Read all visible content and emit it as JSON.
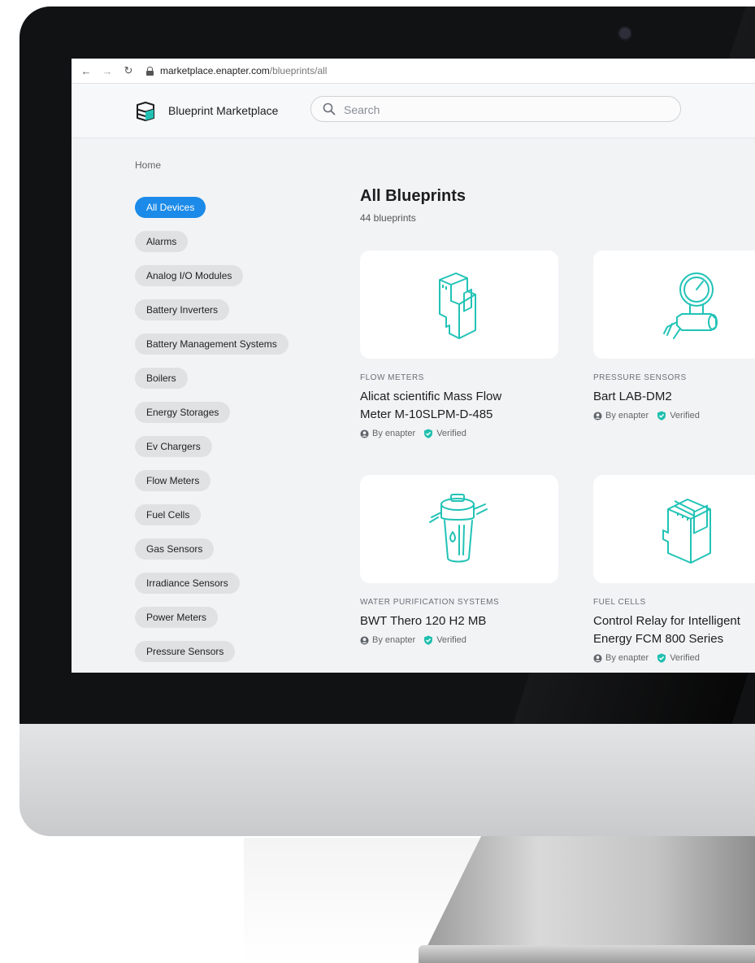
{
  "browser": {
    "url_host": "marketplace.enapter.com",
    "url_path": "/blueprints/all"
  },
  "header": {
    "brand": "Blueprint Marketplace",
    "search_placeholder": "Search"
  },
  "breadcrumb": "Home",
  "sidebar": {
    "items": [
      {
        "label": "All Devices",
        "active": true
      },
      {
        "label": "Alarms"
      },
      {
        "label": "Analog I/O Modules"
      },
      {
        "label": "Battery Inverters"
      },
      {
        "label": "Battery Management Systems"
      },
      {
        "label": "Boilers"
      },
      {
        "label": "Energy Storages"
      },
      {
        "label": "Ev Chargers"
      },
      {
        "label": "Flow Meters"
      },
      {
        "label": "Fuel Cells"
      },
      {
        "label": "Gas Sensors"
      },
      {
        "label": "Irradiance Sensors"
      },
      {
        "label": "Power Meters"
      },
      {
        "label": "Pressure Sensors"
      }
    ]
  },
  "main": {
    "title": "All Blueprints",
    "count": "44 blueprints",
    "cards": [
      {
        "category": "FLOW METERS",
        "title_line1": "Alicat scientific Mass Flow",
        "title_line2": "Meter M-10SLPM-D-485",
        "author": "By enapter",
        "badge": "Verified",
        "icon": "din-rail-module-icon"
      },
      {
        "category": "PRESSURE SENSORS",
        "title_line1": "Bart LAB-DM2",
        "title_line2": "",
        "author": "By enapter",
        "badge": "Verified",
        "icon": "pressure-gauge-icon"
      },
      {
        "category": "WATER PURIFICATION SYSTEMS",
        "title_line1": "BWT Thero 120 H2 MB",
        "title_line2": "",
        "author": "By enapter",
        "badge": "Verified",
        "icon": "water-filter-icon"
      },
      {
        "category": "FUEL CELLS",
        "title_line1": "Control Relay for Intelligent",
        "title_line2": "Energy FCM 800 Series",
        "author": "By enapter",
        "badge": "Verified",
        "icon": "relay-module-icon"
      }
    ]
  },
  "colors": {
    "accent": "#1b8ae8",
    "icon_teal": "#22c3b6",
    "verified_teal": "#1fbfae"
  }
}
